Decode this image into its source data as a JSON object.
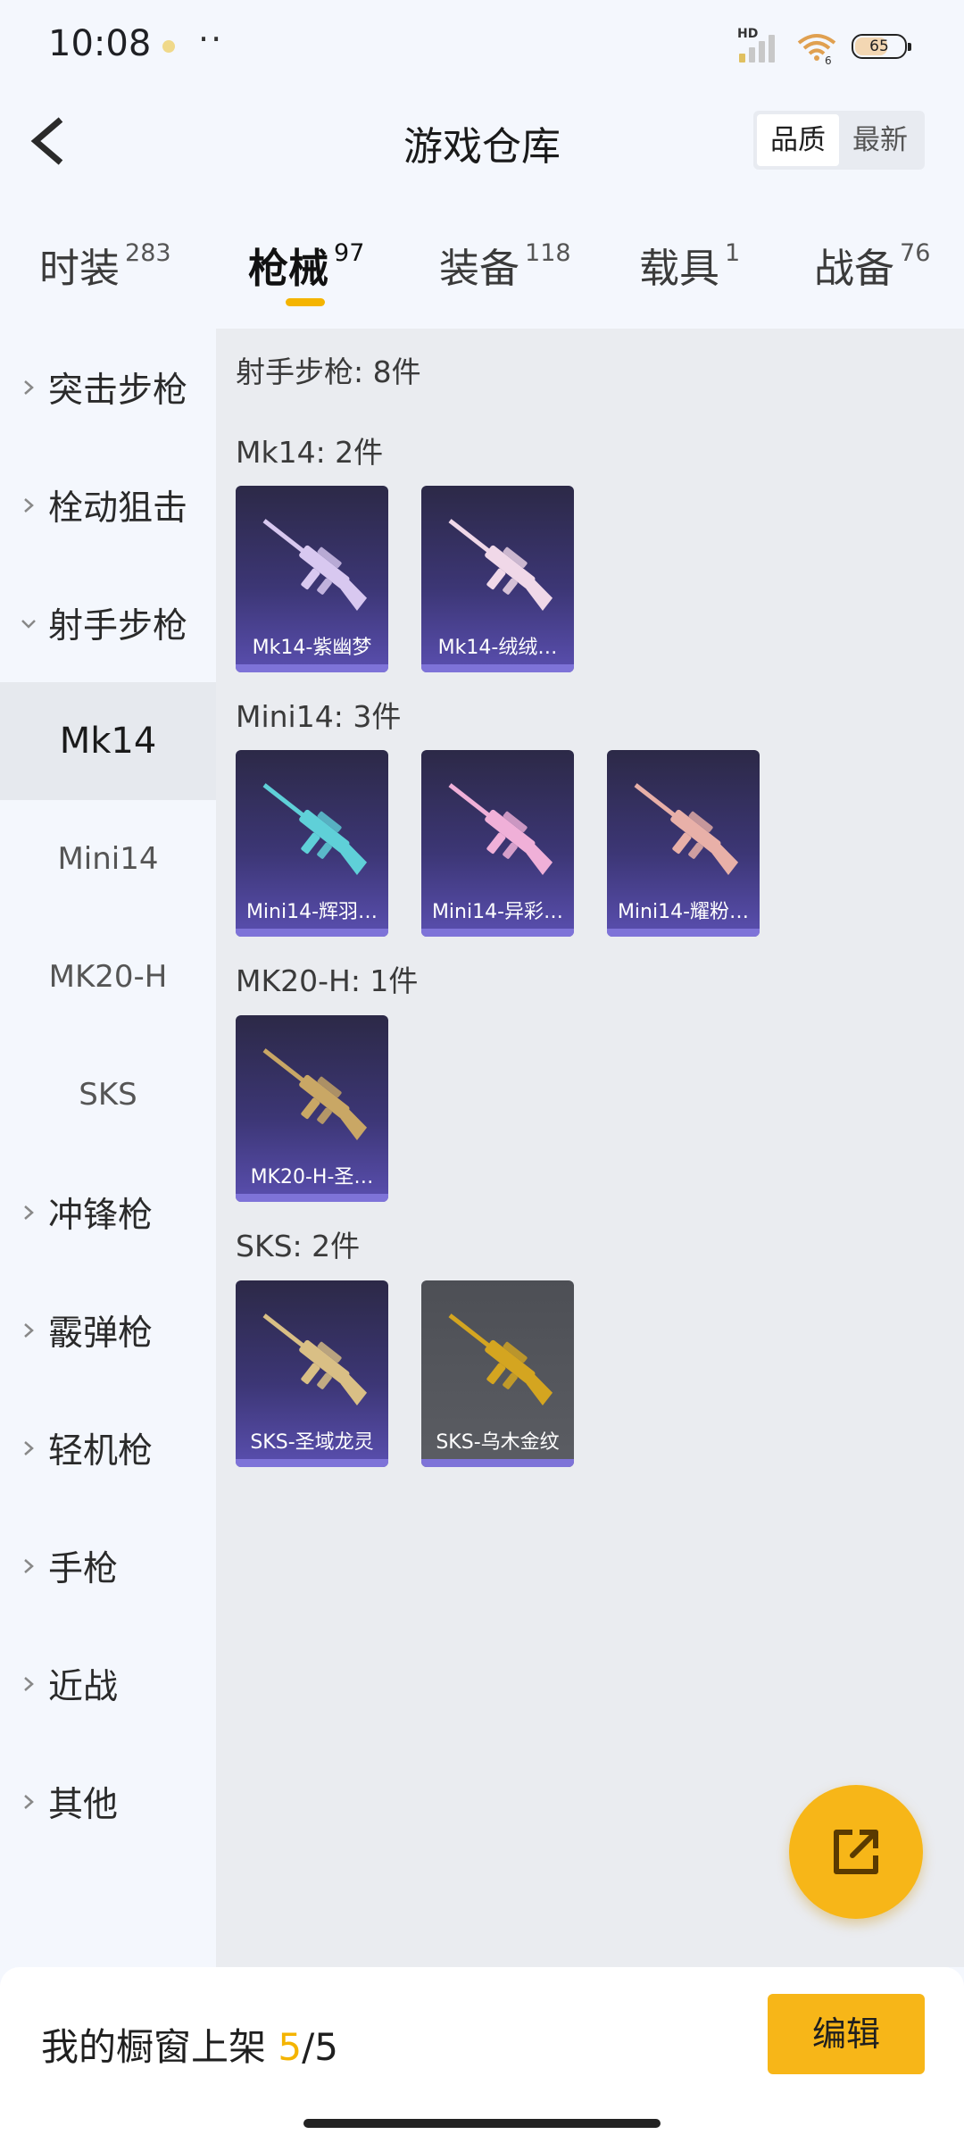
{
  "status_bar": {
    "time": "10:08",
    "battery": "65",
    "signal_badge": "HD",
    "wifi_badge": "6"
  },
  "header": {
    "title": "游戏仓库",
    "sort_options": [
      "品质",
      "最新"
    ],
    "active_sort": "品质"
  },
  "tabs": [
    {
      "label": "时装",
      "count": "283"
    },
    {
      "label": "枪械",
      "count": "97",
      "active": true
    },
    {
      "label": "装备",
      "count": "118"
    },
    {
      "label": "载具",
      "count": "1"
    },
    {
      "label": "战备",
      "count": "76"
    }
  ],
  "sidebar": {
    "categories_top": [
      "突击步枪",
      "栓动狙击",
      "射手步枪"
    ],
    "expanded_category": "射手步枪",
    "subitems": [
      "Mk14",
      "Mini14",
      "MK20-H",
      "SKS"
    ],
    "selected_subitem": "Mk14",
    "categories_bottom": [
      "冲锋枪",
      "霰弹枪",
      "轻机枪",
      "手枪",
      "近战",
      "其他"
    ]
  },
  "content": {
    "summary": "射手步枪: 8件",
    "groups": [
      {
        "heading": "Mk14: 2件",
        "items": [
          {
            "name": "Mk14-紫幽梦",
            "frame": "purple",
            "accent": "#d8c8f0"
          },
          {
            "name": "Mk14-绒绒…",
            "frame": "purple",
            "accent": "#f0d8e8"
          }
        ]
      },
      {
        "heading": "Mini14: 3件",
        "items": [
          {
            "name": "Mini14-辉羽…",
            "frame": "purple",
            "accent": "#5fd0d8"
          },
          {
            "name": "Mini14-异彩…",
            "frame": "purple",
            "accent": "#f0b0d8"
          },
          {
            "name": "Mini14-耀粉…",
            "frame": "purple",
            "accent": "#e8b0a8"
          }
        ]
      },
      {
        "heading": "MK20-H: 1件",
        "items": [
          {
            "name": "MK20-H-圣…",
            "frame": "purple",
            "accent": "#c9a765"
          }
        ]
      },
      {
        "heading": "SKS: 2件",
        "items": [
          {
            "name": "SKS-圣域龙灵",
            "frame": "purple",
            "accent": "#d9bf85"
          },
          {
            "name": "SKS-乌木金纹",
            "frame": "grey",
            "accent": "#d4a520"
          }
        ]
      }
    ]
  },
  "bottom_bar": {
    "label": "我的橱窗上架 ",
    "current": "5",
    "separator": "/",
    "total": "5",
    "edit_label": "编辑"
  },
  "colors": {
    "accent": "#f7b618",
    "card_purple": "#3c3675",
    "card_grey": "#5b5d63"
  },
  "icons": {
    "back": "chevron-left-icon",
    "share": "external-link-icon",
    "expand": "chevron-right-icon",
    "expanded": "chevron-down-icon"
  }
}
